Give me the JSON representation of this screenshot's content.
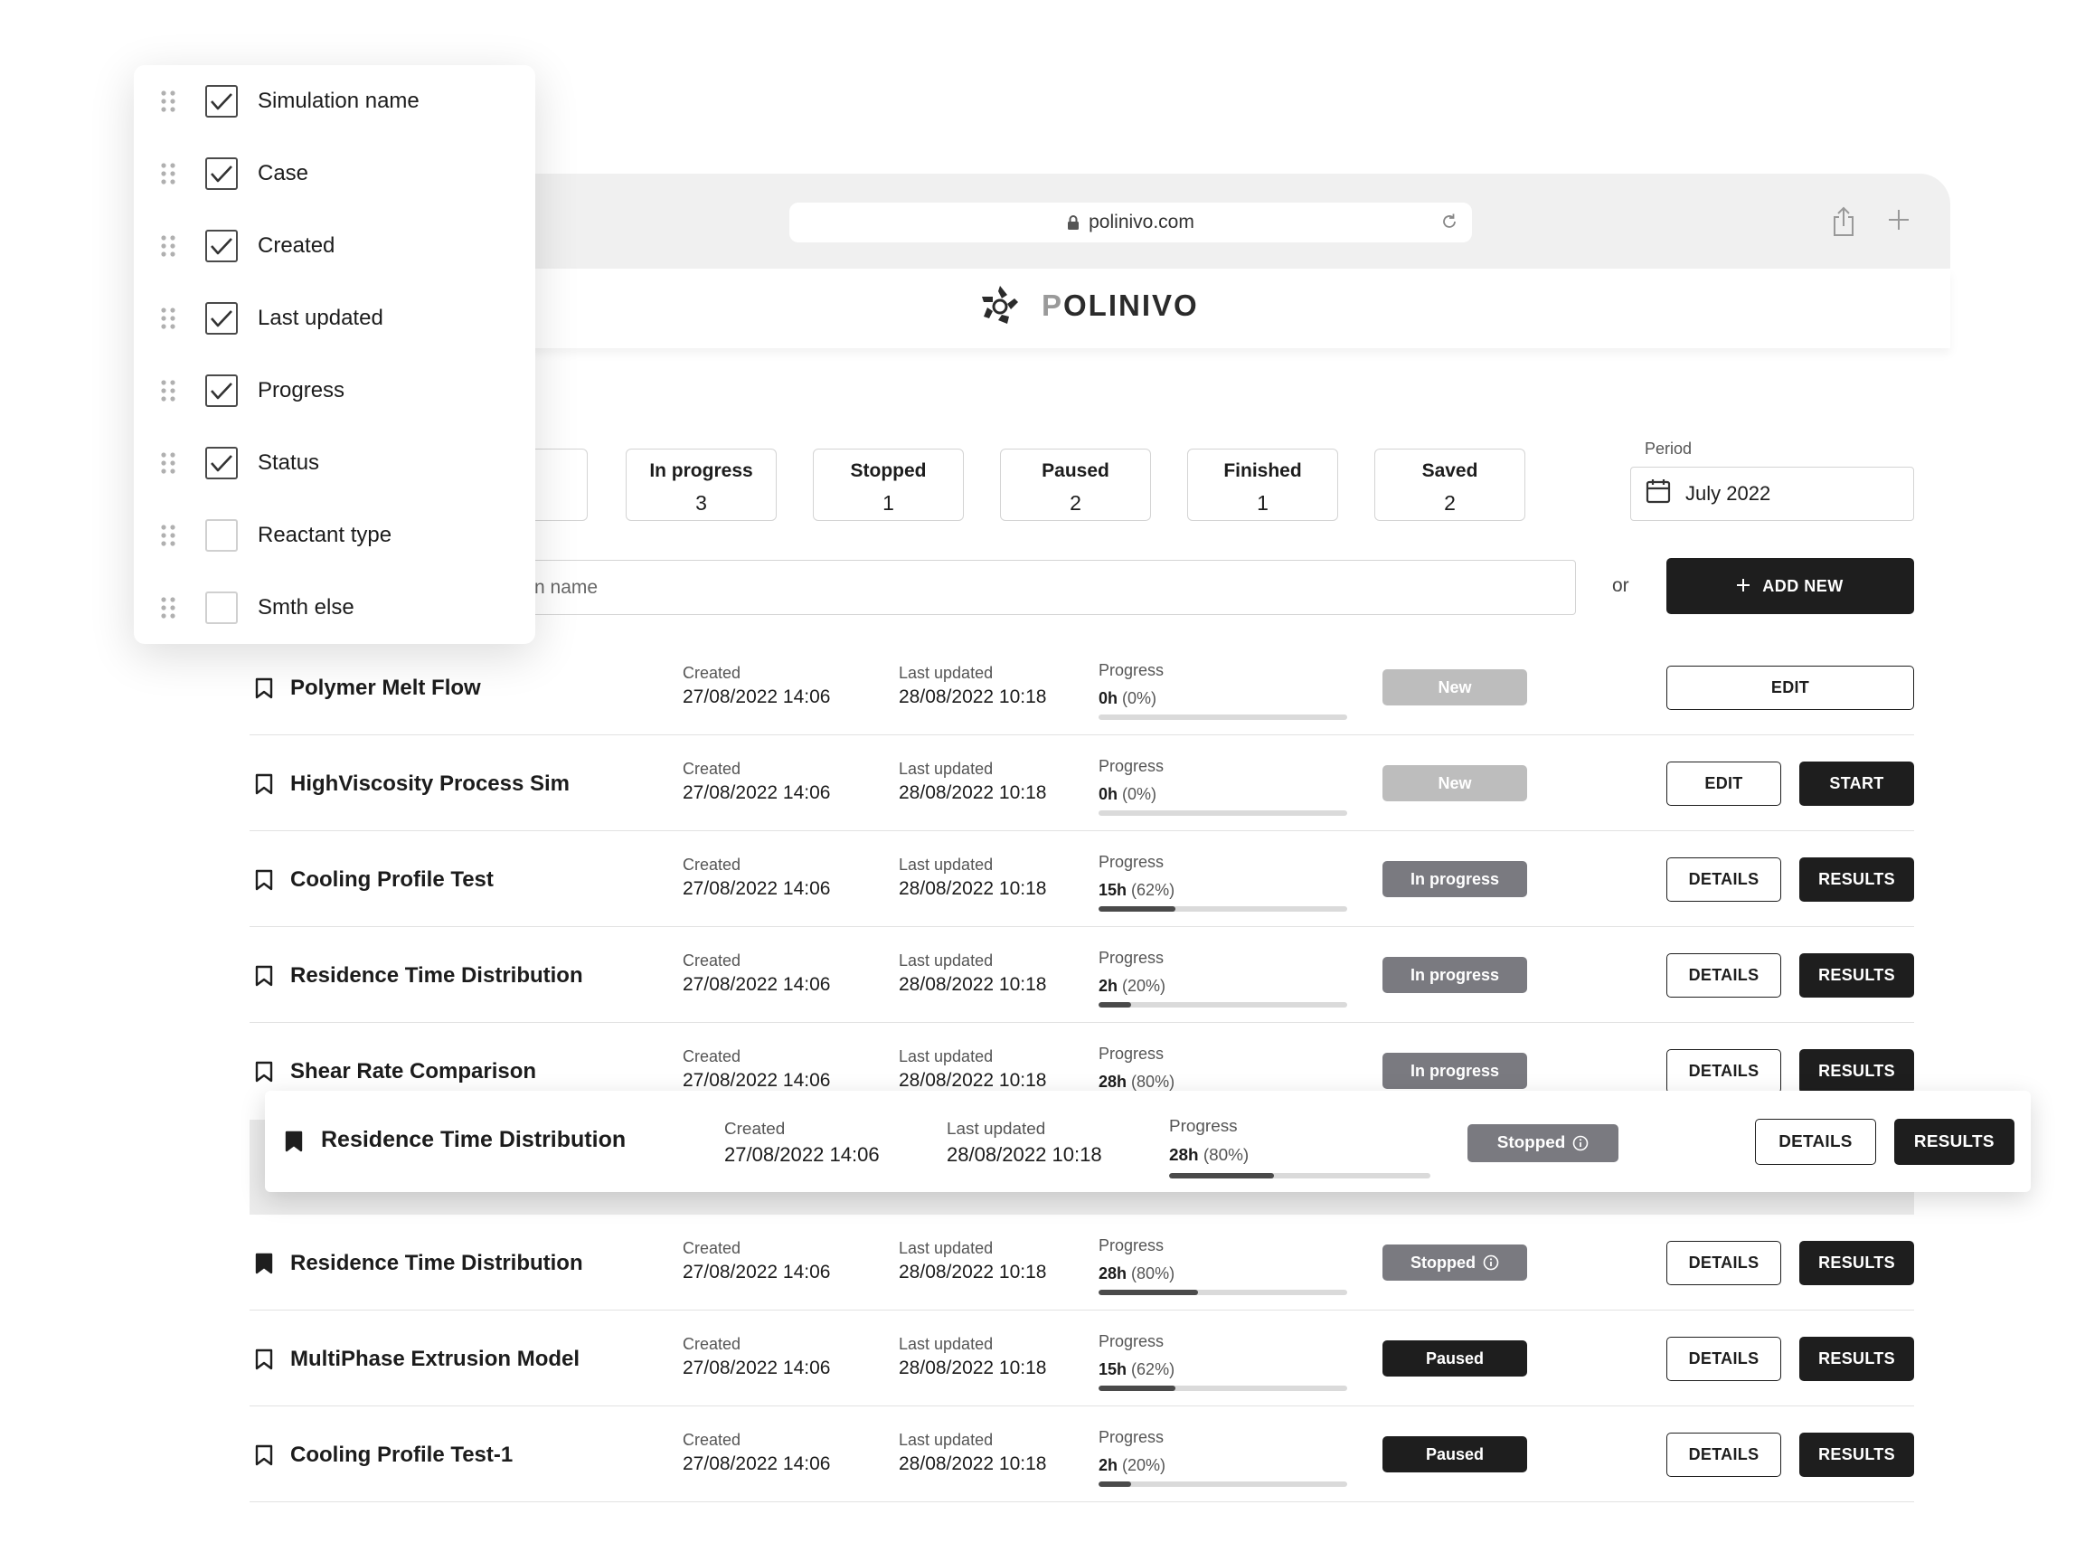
{
  "browser": {
    "url": "polinivo.com",
    "brand": "POLINIVO",
    "icons": [
      "lock-icon",
      "reload-icon",
      "share-icon",
      "plus-icon"
    ]
  },
  "filters": [
    {
      "label": "In progress",
      "count": "3"
    },
    {
      "label": "Stopped",
      "count": "1"
    },
    {
      "label": "Paused",
      "count": "2"
    },
    {
      "label": "Finished",
      "count": "1"
    },
    {
      "label": "Saved",
      "count": "2"
    }
  ],
  "period": {
    "label": "Period",
    "value": "July 2022"
  },
  "search": {
    "placeholder_visible": "n name",
    "or": "or",
    "add_new": "ADD NEW"
  },
  "labels": {
    "created": "Created",
    "last_updated": "Last updated",
    "progress": "Progress"
  },
  "rows": [
    {
      "name": "Polymer Melt Flow",
      "created": "27/08/2022 14:06",
      "updated": "28/08/2022 10:18",
      "progress_hours": "0h",
      "progress_pct": "(0%)",
      "progress_fraction": 0,
      "status": "New",
      "status_type": "new",
      "buttons": [
        "EDIT"
      ]
    },
    {
      "name": "HighViscosity Process Sim",
      "created": "27/08/2022 14:06",
      "updated": "28/08/2022 10:18",
      "progress_hours": "0h",
      "progress_pct": "(0%)",
      "progress_fraction": 0,
      "status": "New",
      "status_type": "new",
      "buttons": [
        "EDIT",
        "START"
      ]
    },
    {
      "name": "Cooling Profile Test",
      "created": "27/08/2022 14:06",
      "updated": "28/08/2022 10:18",
      "progress_hours": "15h",
      "progress_pct": "(62%)",
      "progress_fraction": 0.31,
      "status": "In progress",
      "status_type": "inprogress",
      "buttons": [
        "DETAILS",
        "RESULTS"
      ]
    },
    {
      "name": "Residence Time Distribution",
      "created": "27/08/2022 14:06",
      "updated": "28/08/2022 10:18",
      "progress_hours": "2h",
      "progress_pct": "(20%)",
      "progress_fraction": 0.13,
      "status": "In progress",
      "status_type": "inprogress",
      "buttons": [
        "DETAILS",
        "RESULTS"
      ]
    },
    {
      "name": "Shear Rate Comparison",
      "created": "27/08/2022 14:06",
      "updated": "28/08/2022 10:18",
      "progress_hours": "28h",
      "progress_pct": "(80%)",
      "progress_fraction": 0.4,
      "status": "In progress",
      "status_type": "inprogress",
      "buttons": [
        "DETAILS",
        "RESULTS"
      ]
    },
    {
      "name": "Residence Time Distribution",
      "created": "27/08/2022 14:06",
      "updated": "28/08/2022 10:18",
      "progress_hours": "28h",
      "progress_pct": "(80%)",
      "progress_fraction": 0.4,
      "status": "Stopped",
      "status_type": "stopped",
      "buttons": [
        "DETAILS",
        "RESULTS"
      ]
    },
    {
      "name": "MultiPhase Extrusion Model",
      "created": "27/08/2022 14:06",
      "updated": "28/08/2022 10:18",
      "progress_hours": "15h",
      "progress_pct": "(62%)",
      "progress_fraction": 0.31,
      "status": "Paused",
      "status_type": "paused",
      "buttons": [
        "DETAILS",
        "RESULTS"
      ]
    },
    {
      "name": "Cooling Profile Test-1",
      "created": "27/08/2022 14:06",
      "updated": "28/08/2022 10:18",
      "progress_hours": "2h",
      "progress_pct": "(20%)",
      "progress_fraction": 0.13,
      "status": "Paused",
      "status_type": "paused",
      "buttons": [
        "DETAILS",
        "RESULTS"
      ]
    }
  ],
  "dragged_row": {
    "name": "Residence Time Distribution",
    "created": "27/08/2022 14:06",
    "updated": "28/08/2022 10:18",
    "progress_hours": "28h",
    "progress_pct": "(80%)",
    "progress_fraction": 0.4,
    "status": "Stopped",
    "status_type": "stopped",
    "buttons": [
      "DETAILS",
      "RESULTS"
    ]
  },
  "columns": [
    {
      "label": "Simulation name",
      "checked": true
    },
    {
      "label": "Case",
      "checked": true
    },
    {
      "label": "Created",
      "checked": true
    },
    {
      "label": "Last updated",
      "checked": true
    },
    {
      "label": "Progress",
      "checked": true
    },
    {
      "label": "Status",
      "checked": true
    },
    {
      "label": "Reactant type",
      "checked": false
    },
    {
      "label": "Smth else",
      "checked": false
    }
  ],
  "colors": {
    "dark": "#1e1e1e",
    "badge_new": "#bdbdbd",
    "badge_gray": "#7a7a80",
    "border": "#d4d4d4"
  }
}
